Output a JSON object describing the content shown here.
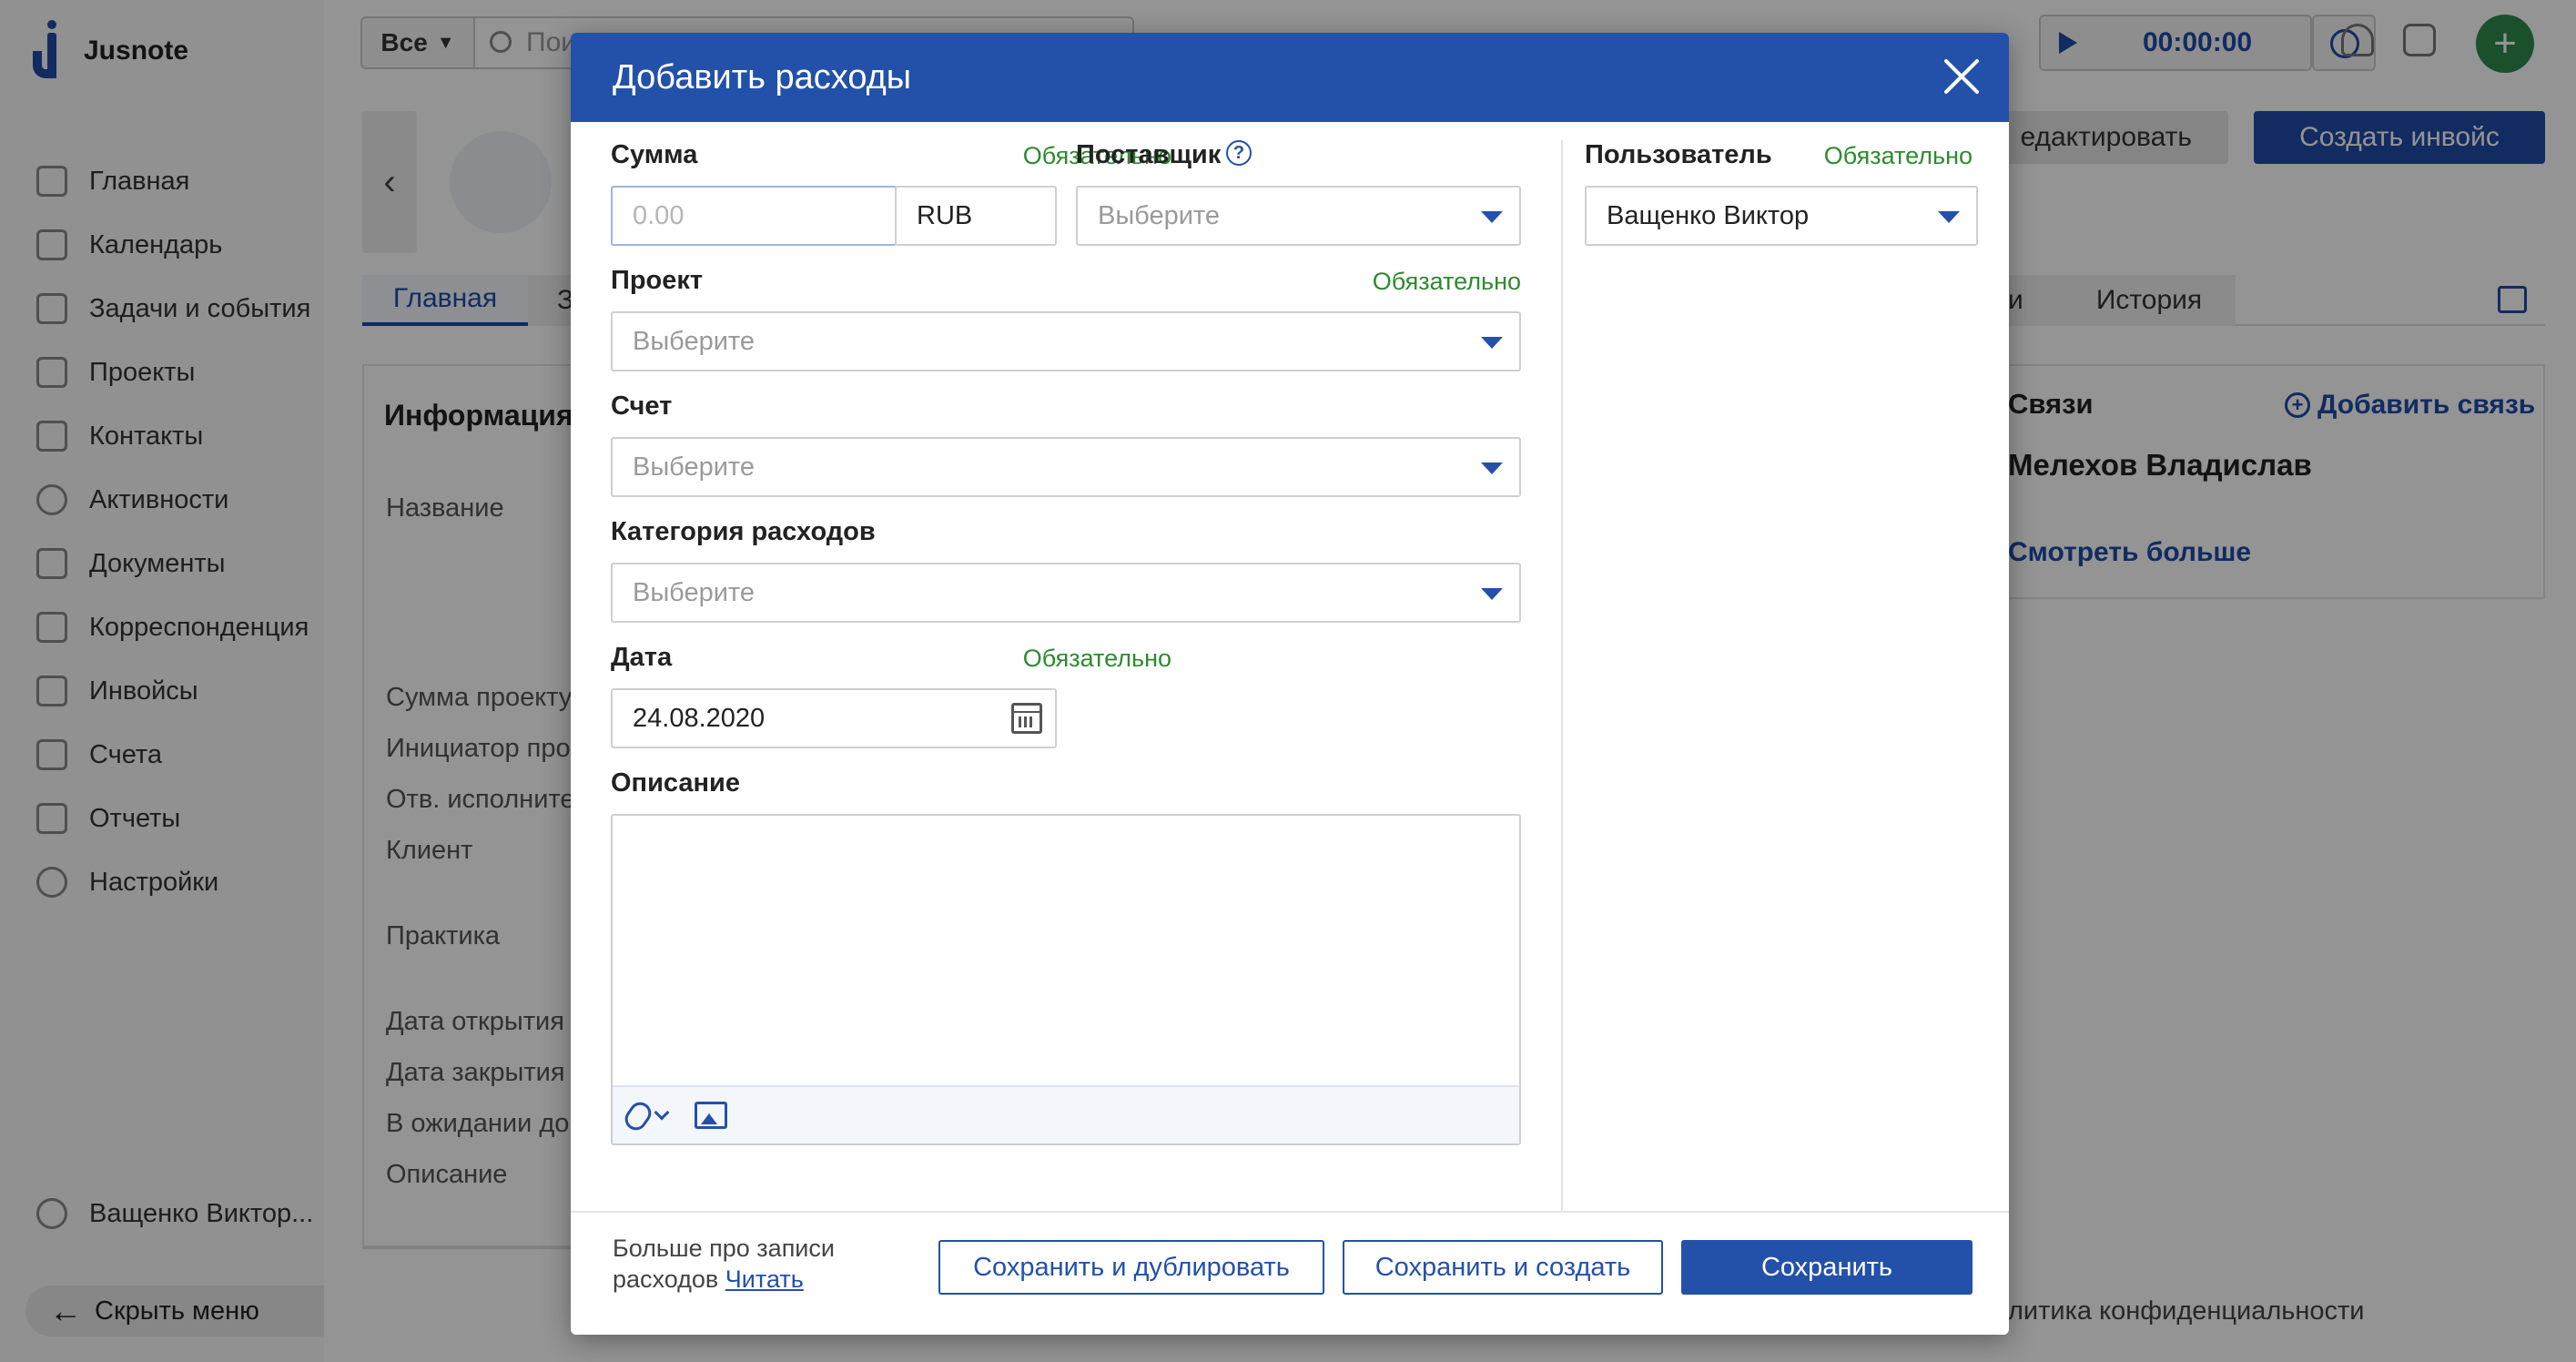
{
  "app": {
    "name": "Jusnote",
    "sidebar": {
      "items": [
        {
          "label": "Главная",
          "icon": "home-icon"
        },
        {
          "label": "Календарь",
          "icon": "calendar-icon"
        },
        {
          "label": "Задачи и события",
          "icon": "tasks-icon"
        },
        {
          "label": "Проекты",
          "icon": "projects-icon"
        },
        {
          "label": "Контакты",
          "icon": "contacts-icon"
        },
        {
          "label": "Активности",
          "icon": "activity-icon"
        },
        {
          "label": "Документы",
          "icon": "documents-icon"
        },
        {
          "label": "Корреспонденция",
          "icon": "mail-icon"
        },
        {
          "label": "Инвойсы",
          "icon": "invoice-icon"
        },
        {
          "label": "Счета",
          "icon": "accounts-icon"
        },
        {
          "label": "Отчеты",
          "icon": "reports-icon"
        },
        {
          "label": "Настройки",
          "icon": "settings-icon"
        }
      ],
      "user": "Ващенко Виктор...",
      "hide_menu": "Скрыть меню"
    },
    "topbar": {
      "filter": "Все",
      "search_placeholder": "Пои",
      "timer": "00:00:00"
    },
    "project": {
      "edit_button": "едактировать",
      "create_invoice_button": "Создать инвойс",
      "tabs": [
        "Главная",
        "З",
        "и",
        "История"
      ],
      "info_title": "Информация",
      "info_labels": [
        "Название",
        "Сумма проекту",
        "Инициатор про",
        "Отв. исполните",
        "Клиент",
        "Практика",
        "Дата открытия",
        "Дата закрытия",
        "В ожидании до",
        "Описание"
      ],
      "links_title": "Связи",
      "links_add": "Добавить связь",
      "links_name": "Мелехов Владислав",
      "links_more": "Смотреть больше",
      "privacy": "литика конфиденциальности"
    }
  },
  "modal": {
    "title": "Добавить расходы",
    "required_label": "Обязательно",
    "amount": {
      "label": "Сумма",
      "placeholder": "0.00",
      "currency": "RUB"
    },
    "supplier": {
      "label": "Поставщик",
      "placeholder": "Выберите"
    },
    "user": {
      "label": "Пользователь",
      "value": "Ващенко Виктор"
    },
    "project": {
      "label": "Проект",
      "placeholder": "Выберите"
    },
    "account": {
      "label": "Счет",
      "placeholder": "Выберите"
    },
    "category": {
      "label": "Категория расходов",
      "placeholder": "Выберите"
    },
    "date": {
      "label": "Дата",
      "value": "24.08.2020"
    },
    "description": {
      "label": "Описание"
    },
    "footer": {
      "note_prefix": "Больше про записи расходов",
      "note_link": "Читать",
      "save_duplicate": "Сохранить и дублировать",
      "save_create": "Сохранить и создать",
      "save": "Сохранить"
    }
  }
}
